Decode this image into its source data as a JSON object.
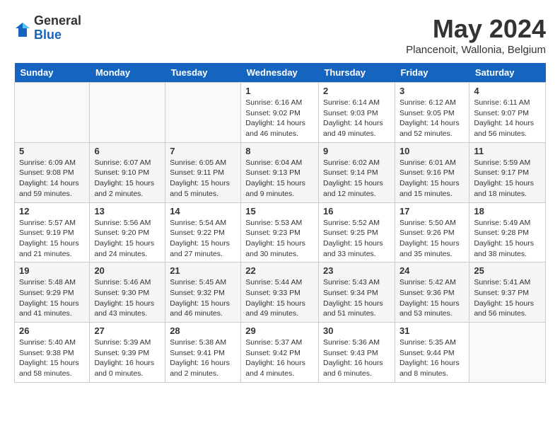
{
  "header": {
    "logo_general": "General",
    "logo_blue": "Blue",
    "month": "May 2024",
    "location": "Plancenoit, Wallonia, Belgium"
  },
  "weekdays": [
    "Sunday",
    "Monday",
    "Tuesday",
    "Wednesday",
    "Thursday",
    "Friday",
    "Saturday"
  ],
  "weeks": [
    [
      {
        "day": "",
        "info": ""
      },
      {
        "day": "",
        "info": ""
      },
      {
        "day": "",
        "info": ""
      },
      {
        "day": "1",
        "info": "Sunrise: 6:16 AM\nSunset: 9:02 PM\nDaylight: 14 hours\nand 46 minutes."
      },
      {
        "day": "2",
        "info": "Sunrise: 6:14 AM\nSunset: 9:03 PM\nDaylight: 14 hours\nand 49 minutes."
      },
      {
        "day": "3",
        "info": "Sunrise: 6:12 AM\nSunset: 9:05 PM\nDaylight: 14 hours\nand 52 minutes."
      },
      {
        "day": "4",
        "info": "Sunrise: 6:11 AM\nSunset: 9:07 PM\nDaylight: 14 hours\nand 56 minutes."
      }
    ],
    [
      {
        "day": "5",
        "info": "Sunrise: 6:09 AM\nSunset: 9:08 PM\nDaylight: 14 hours\nand 59 minutes."
      },
      {
        "day": "6",
        "info": "Sunrise: 6:07 AM\nSunset: 9:10 PM\nDaylight: 15 hours\nand 2 minutes."
      },
      {
        "day": "7",
        "info": "Sunrise: 6:05 AM\nSunset: 9:11 PM\nDaylight: 15 hours\nand 5 minutes."
      },
      {
        "day": "8",
        "info": "Sunrise: 6:04 AM\nSunset: 9:13 PM\nDaylight: 15 hours\nand 9 minutes."
      },
      {
        "day": "9",
        "info": "Sunrise: 6:02 AM\nSunset: 9:14 PM\nDaylight: 15 hours\nand 12 minutes."
      },
      {
        "day": "10",
        "info": "Sunrise: 6:01 AM\nSunset: 9:16 PM\nDaylight: 15 hours\nand 15 minutes."
      },
      {
        "day": "11",
        "info": "Sunrise: 5:59 AM\nSunset: 9:17 PM\nDaylight: 15 hours\nand 18 minutes."
      }
    ],
    [
      {
        "day": "12",
        "info": "Sunrise: 5:57 AM\nSunset: 9:19 PM\nDaylight: 15 hours\nand 21 minutes."
      },
      {
        "day": "13",
        "info": "Sunrise: 5:56 AM\nSunset: 9:20 PM\nDaylight: 15 hours\nand 24 minutes."
      },
      {
        "day": "14",
        "info": "Sunrise: 5:54 AM\nSunset: 9:22 PM\nDaylight: 15 hours\nand 27 minutes."
      },
      {
        "day": "15",
        "info": "Sunrise: 5:53 AM\nSunset: 9:23 PM\nDaylight: 15 hours\nand 30 minutes."
      },
      {
        "day": "16",
        "info": "Sunrise: 5:52 AM\nSunset: 9:25 PM\nDaylight: 15 hours\nand 33 minutes."
      },
      {
        "day": "17",
        "info": "Sunrise: 5:50 AM\nSunset: 9:26 PM\nDaylight: 15 hours\nand 35 minutes."
      },
      {
        "day": "18",
        "info": "Sunrise: 5:49 AM\nSunset: 9:28 PM\nDaylight: 15 hours\nand 38 minutes."
      }
    ],
    [
      {
        "day": "19",
        "info": "Sunrise: 5:48 AM\nSunset: 9:29 PM\nDaylight: 15 hours\nand 41 minutes."
      },
      {
        "day": "20",
        "info": "Sunrise: 5:46 AM\nSunset: 9:30 PM\nDaylight: 15 hours\nand 43 minutes."
      },
      {
        "day": "21",
        "info": "Sunrise: 5:45 AM\nSunset: 9:32 PM\nDaylight: 15 hours\nand 46 minutes."
      },
      {
        "day": "22",
        "info": "Sunrise: 5:44 AM\nSunset: 9:33 PM\nDaylight: 15 hours\nand 49 minutes."
      },
      {
        "day": "23",
        "info": "Sunrise: 5:43 AM\nSunset: 9:34 PM\nDaylight: 15 hours\nand 51 minutes."
      },
      {
        "day": "24",
        "info": "Sunrise: 5:42 AM\nSunset: 9:36 PM\nDaylight: 15 hours\nand 53 minutes."
      },
      {
        "day": "25",
        "info": "Sunrise: 5:41 AM\nSunset: 9:37 PM\nDaylight: 15 hours\nand 56 minutes."
      }
    ],
    [
      {
        "day": "26",
        "info": "Sunrise: 5:40 AM\nSunset: 9:38 PM\nDaylight: 15 hours\nand 58 minutes."
      },
      {
        "day": "27",
        "info": "Sunrise: 5:39 AM\nSunset: 9:39 PM\nDaylight: 16 hours\nand 0 minutes."
      },
      {
        "day": "28",
        "info": "Sunrise: 5:38 AM\nSunset: 9:41 PM\nDaylight: 16 hours\nand 2 minutes."
      },
      {
        "day": "29",
        "info": "Sunrise: 5:37 AM\nSunset: 9:42 PM\nDaylight: 16 hours\nand 4 minutes."
      },
      {
        "day": "30",
        "info": "Sunrise: 5:36 AM\nSunset: 9:43 PM\nDaylight: 16 hours\nand 6 minutes."
      },
      {
        "day": "31",
        "info": "Sunrise: 5:35 AM\nSunset: 9:44 PM\nDaylight: 16 hours\nand 8 minutes."
      },
      {
        "day": "",
        "info": ""
      }
    ]
  ]
}
